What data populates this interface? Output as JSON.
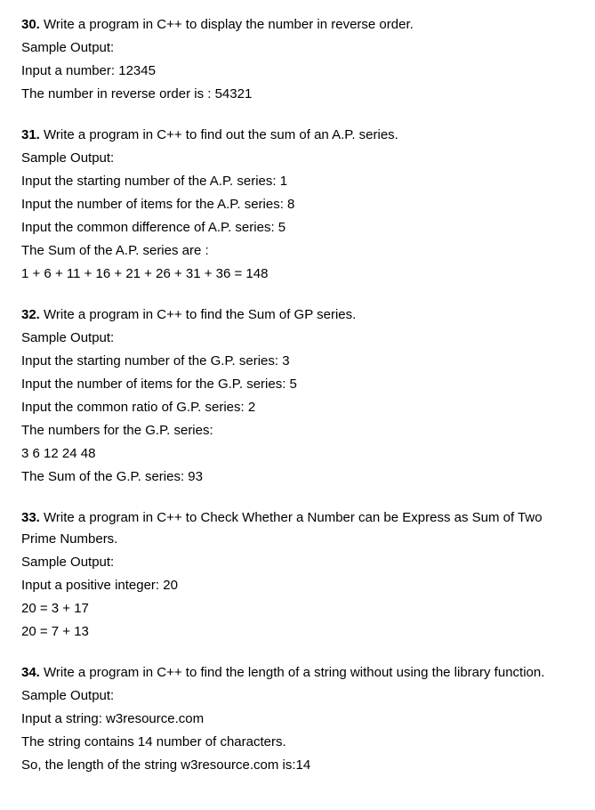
{
  "exercises": [
    {
      "number": "30.",
      "title": " Write a program in C++ to display the number in reverse order.",
      "lines": [
        "Sample Output:",
        "Input a number: 12345",
        "The number in reverse order is : 54321"
      ]
    },
    {
      "number": "31.",
      "title": " Write a program in C++ to find out the sum of an A.P. series.",
      "lines": [
        "Sample Output:",
        "Input the starting number of the A.P. series: 1",
        "Input the number of items for the A.P. series: 8",
        "Input the common difference of A.P. series: 5",
        "The Sum of the A.P. series are :",
        "1 + 6 + 11 + 16 + 21 + 26 + 31 + 36 = 148"
      ]
    },
    {
      "number": "32.",
      "title": " Write a program in C++ to find the Sum of GP series.",
      "lines": [
        "Sample Output:",
        "Input the starting number of the G.P. series: 3",
        "Input the number of items for the G.P. series: 5",
        "Input the common ratio of G.P. series: 2",
        "The numbers for the G.P. series:",
        "3 6 12 24 48",
        "The Sum of the G.P. series: 93"
      ]
    },
    {
      "number": "33.",
      "title": " Write a program in C++ to Check Whether a Number can be Express as Sum of Two Prime Numbers.",
      "lines": [
        "Sample Output:",
        "Input a positive integer: 20",
        "20 = 3 + 17",
        "20 = 7 + 13"
      ]
    },
    {
      "number": "34.",
      "title": " Write a program in C++ to find the length of a string without using the library function.",
      "lines": [
        "Sample Output:",
        "Input a string: w3resource.com",
        "The string contains 14 number of characters.",
        "So, the length of the string w3resource.com is:14"
      ]
    }
  ]
}
